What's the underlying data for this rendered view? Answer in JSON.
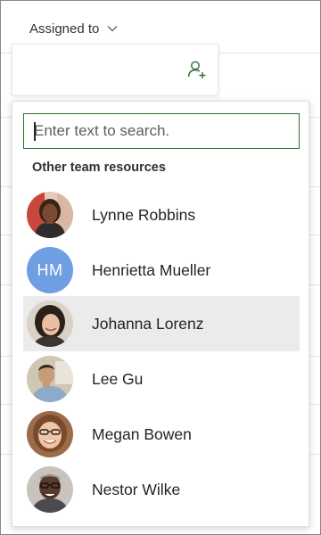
{
  "header": {
    "label": "Assigned to",
    "chevron_icon": "chevron-down-icon"
  },
  "assign_box": {
    "icon": "add-user-icon"
  },
  "search": {
    "placeholder": "Enter text to search.",
    "value": ""
  },
  "section": {
    "title": "Other team resources"
  },
  "people": [
    {
      "name": "Lynne Robbins",
      "avatar": "photo"
    },
    {
      "name": "Henrietta Mueller",
      "avatar": "initials",
      "initials": "HM",
      "avatar_color": "#6f9ee3"
    },
    {
      "name": "Johanna Lorenz",
      "avatar": "photo",
      "selected": true
    },
    {
      "name": "Lee Gu",
      "avatar": "photo"
    },
    {
      "name": "Megan Bowen",
      "avatar": "photo"
    },
    {
      "name": "Nestor Wilke",
      "avatar": "photo"
    }
  ],
  "colors": {
    "search_border": "#2f6f2f",
    "selected_row": "#ebebeb",
    "accent_green": "#2f6f2f"
  }
}
